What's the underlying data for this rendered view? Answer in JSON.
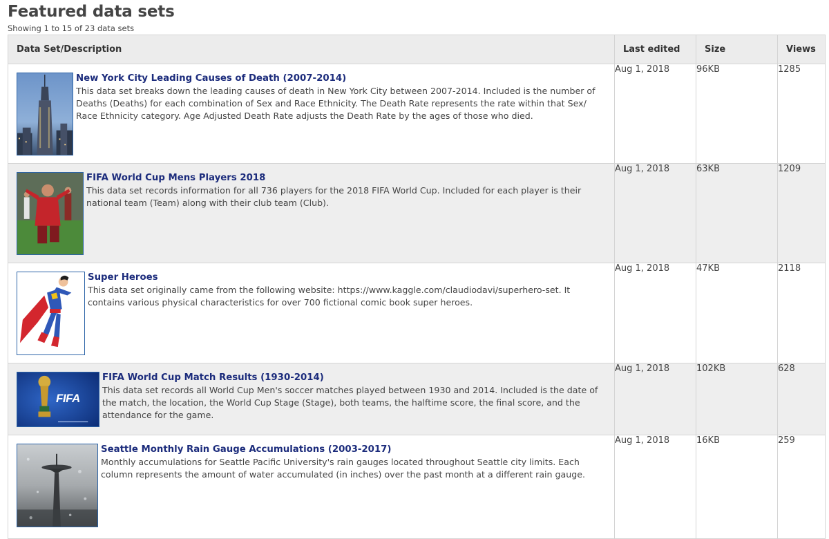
{
  "header": {
    "title": "Featured data sets",
    "showing": "Showing 1 to 15 of 23 data sets"
  },
  "table": {
    "columns": [
      "Data Set/Description",
      "Last edited",
      "Size",
      "Views"
    ],
    "rows": [
      {
        "title": "New York City Leading Causes of Death (2007-2014)",
        "description": "This data set breaks down the leading causes of death in New York City between 2007-2014. Included is the number of Deaths (Deaths) for each combination of Sex and Race Ethnicity. The Death Rate represents the rate within that Sex/ Race Ethnicity category. Age Adjusted Death Rate adjusts the Death Rate by the ages of those who died.",
        "last_edited": "Aug 1, 2018",
        "size": "96KB",
        "views": "1285",
        "thumbnail": "empire-state-building-photo"
      },
      {
        "title": "FIFA World Cup Mens Players 2018",
        "description": "This data set records information for all 736 players for the 2018 FIFA World Cup. Included for each player is their national team (Team) along with their club team (Club).",
        "last_edited": "Aug 1, 2018",
        "size": "63KB",
        "views": "1209",
        "thumbnail": "soccer-player-photo"
      },
      {
        "title": "Super Heroes",
        "description": "This data set originally came from the following website: https://www.kaggle.com/claudiodavi/superhero-set. It contains various physical characteristics for over 700 fictional comic book super heroes.",
        "last_edited": "Aug 1, 2018",
        "size": "47KB",
        "views": "2118",
        "thumbnail": "superhero-illustration"
      },
      {
        "title": "FIFA World Cup Match Results (1930-2014)",
        "description": "This data set records all World Cup Men's soccer matches played between 1930 and 2014. Included is the date of the match, the location, the World Cup Stage (Stage), both teams, the halftime score, the final score, and the attendance for the game.",
        "last_edited": "Aug 1, 2018",
        "size": "102KB",
        "views": "628",
        "thumbnail": "world-cup-trophy-image",
        "thumbnail_text": "FIFA"
      },
      {
        "title": "Seattle Monthly Rain Gauge Accumulations (2003-2017)",
        "description": "Monthly accumulations for Seattle Pacific University's rain gauges located throughout Seattle city limits. Each column represents the amount of water accumulated (in inches) over the past month at a different rain gauge.",
        "last_edited": "Aug 1, 2018",
        "size": "16KB",
        "views": "259",
        "thumbnail": "space-needle-rain-photo"
      }
    ]
  },
  "colors": {
    "link": "#1c2c7c",
    "header_bg": "#ececec",
    "alt_row_bg": "#eeeeee",
    "border": "#d4d4d4",
    "thumb_border": "#2b63a7"
  }
}
